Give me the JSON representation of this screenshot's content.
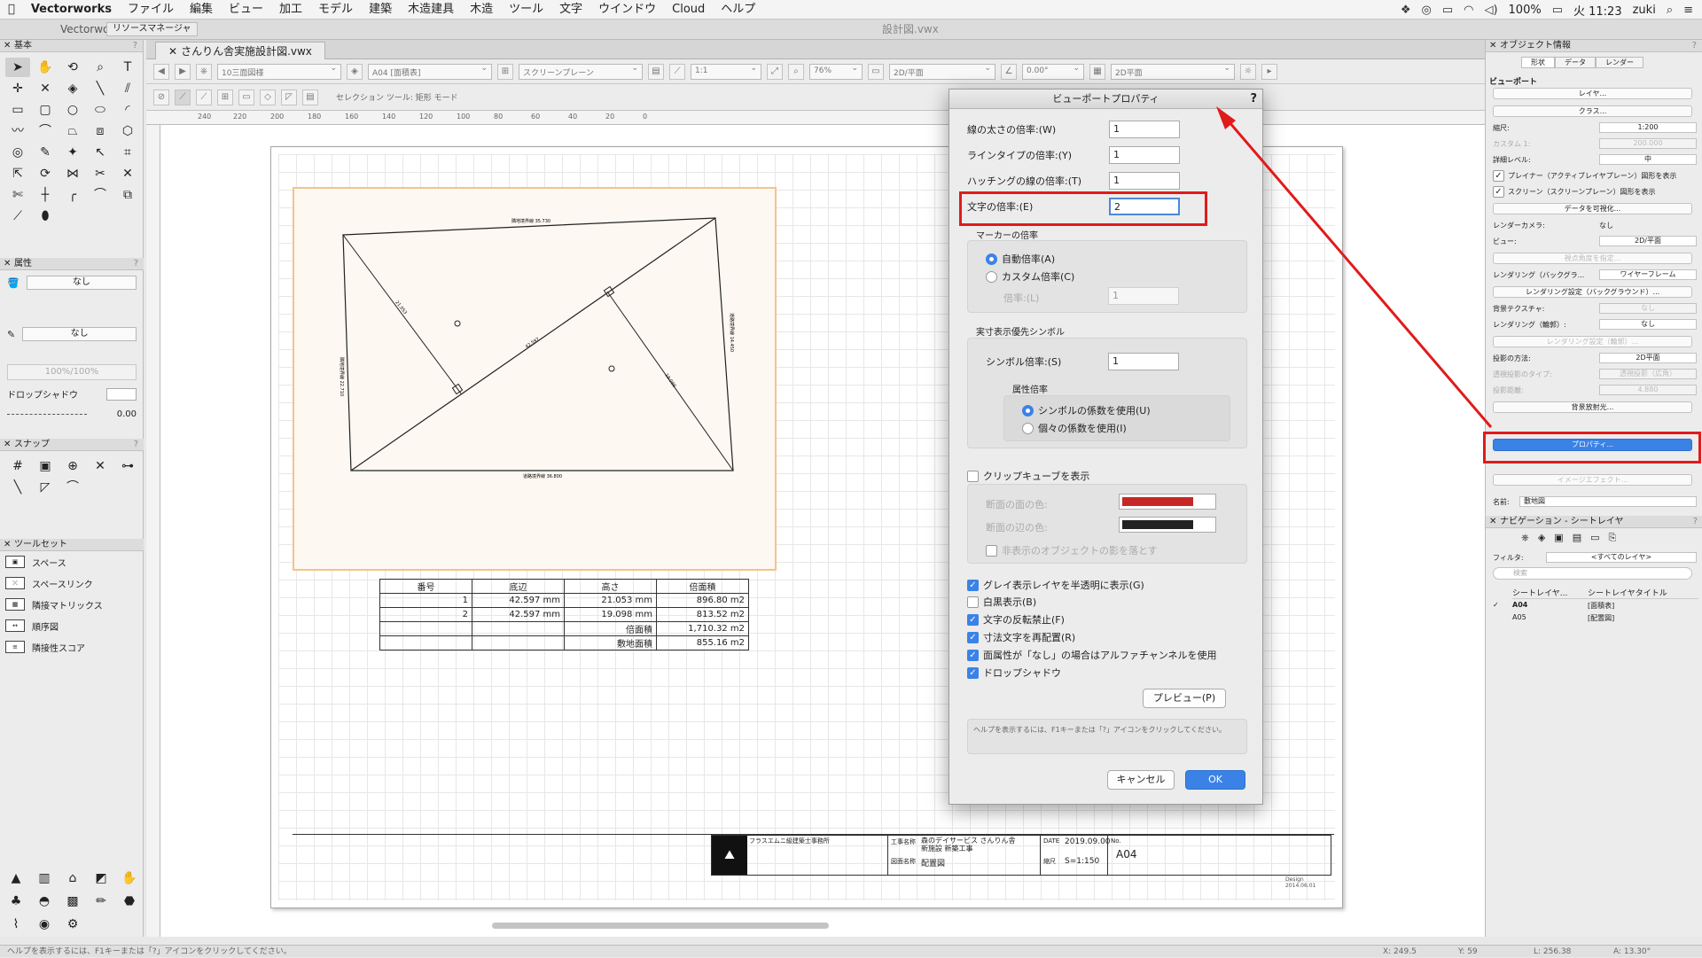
{
  "menubar": {
    "app": "Vectorworks",
    "items": [
      "ファイル",
      "編集",
      "ビュー",
      "加工",
      "モデル",
      "建築",
      "木造建具",
      "木造",
      "ツール",
      "文字",
      "ウインドウ",
      "Cloud",
      "ヘルプ"
    ],
    "battery": "100%",
    "date": "火 11:23",
    "user": "zuki"
  },
  "background_window_title": "Vectorworks",
  "background_doc_title": "設計図.vwx",
  "resource_manager": "リソースマネージャ",
  "doc_tab": "さんりん舎実施設計図.vwx",
  "toolbar": {
    "class": "10三面図様",
    "layer": "A04 [面積表]",
    "plane": "スクリーンプレーン",
    "scale": "1:1",
    "zoom": "76%",
    "view": "2D/平面",
    "angle": "0.00°",
    "render": "2D平面"
  },
  "mode_label": "セレクション ツール: 矩形 モード",
  "left": {
    "basic": "基本",
    "attributes": "属性",
    "fill": "なし",
    "pen": "なし",
    "opacity": "100%/100%",
    "dropshadow": "ドロップシャドウ",
    "lineweight": "0.00",
    "snap": "スナップ",
    "toolset": "ツールセット",
    "toolset_items": [
      "スペース",
      "スペースリンク",
      "隣接マトリックス",
      "順序図",
      "隣接性スコア"
    ]
  },
  "drawing": {
    "top_edge": "隣地境界線 35.730",
    "bottom_edge": "道路境界線 36.800",
    "left_edge": "隣地境界線 22.710",
    "right_edge": "道路境界線 14.450",
    "diag": "42.597",
    "h1": "21.053",
    "h2": "19.098"
  },
  "area_table": {
    "header": [
      "番号",
      "底辺",
      "高さ",
      "倍面積"
    ],
    "rows": [
      [
        "1",
        "42.597 mm",
        "21.053 mm",
        "896.80 m2"
      ],
      [
        "2",
        "42.597 mm",
        "19.098 mm",
        "813.52 m2"
      ],
      [
        "",
        "",
        "倍面積",
        "1,710.32 m2"
      ],
      [
        "",
        "",
        "敷地面積",
        "855.16 m2"
      ]
    ]
  },
  "titleblock": {
    "office": "フラスエムニ級建築士事務所",
    "project_label": "工事名称",
    "project": "森のデイサービス さんりん舎",
    "project2": "新施設 新築工事",
    "drawing_label": "図面名称",
    "drawing": "配置図",
    "date_label": "DATE",
    "date": "2019.09.00",
    "scale_label": "縮尺",
    "scale": "S=1:150",
    "no_label": "No.",
    "no": "A04",
    "design": "Design 2014.06.01"
  },
  "dialog": {
    "title": "ビューポートプロパティ",
    "help": "?",
    "line_weight_label": "線の太さの倍率:(W)",
    "line_weight": "1",
    "line_type_label": "ラインタイプの倍率:(Y)",
    "line_type": "1",
    "hatch_label": "ハッチングの線の倍率:(T)",
    "hatch": "1",
    "text_label": "文字の倍率:(E)",
    "text": "2",
    "marker_label": "マーカーの倍率",
    "marker_auto": "自動倍率(A)",
    "marker_custom": "カスタム倍率(C)",
    "marker_scale_label": "倍率:(L)",
    "marker_scale": "1",
    "symbol_section": "実寸表示優先シンボル",
    "symbol_label": "シンボル倍率:(S)",
    "symbol": "1",
    "attr_section": "属性倍率",
    "attr_symbol": "シンボルの係数を使用(U)",
    "attr_each": "個々の係数を使用(I)",
    "clipcube": "クリップキューブを表示",
    "section_fill": "断面の面の色:",
    "section_edge": "断面の辺の色:",
    "hidden_shadow": "非表示のオブジェクトの影を落とす",
    "gray_layers": "グレイ表示レイヤを半透明に表示(G)",
    "bw": "白黒表示(B)",
    "no_flip": "文字の反転禁止(F)",
    "dim_relocate": "寸法文字を再配置(R)",
    "alpha": "面属性が「なし」の場合はアルファチャンネルを使用",
    "shadow": "ドロップシャドウ",
    "preview": "プレビュー(P)",
    "help_text": "ヘルプを表示するには、F1キーまたは「?」アイコンをクリックしてください。",
    "cancel": "キャンセル",
    "ok": "OK",
    "fill_color": "#c62828",
    "edge_color": "#222222"
  },
  "obj_info": {
    "title": "オブジェクト情報",
    "tabs": [
      "形状",
      "データ",
      "レンダー"
    ],
    "section": "ビューポート",
    "layer_btn": "レイヤ...",
    "class_btn": "クラス...",
    "scale_label": "縮尺:",
    "scale": "1:200",
    "custom_label": "カスタム 1:",
    "custom": "200.000",
    "detail_label": "詳細レベル:",
    "detail": "中",
    "planar": "プレイナー（アクティブレイヤプレーン）図形を表示",
    "screen": "スクリーン（スクリーンプレーン）図形を表示",
    "visualize": "データを可視化...",
    "camera_label": "レンダーカメラ:",
    "camera": "なし",
    "view_label": "ビュー:",
    "view": "2D/平面",
    "align": "視点角度を指定...",
    "bg_render_label": "レンダリング（バックグラ...",
    "bg_render": "ワイヤーフレーム",
    "bg_settings": "レンダリング設定（バックグラウンド）...",
    "bg_tex_label": "背景テクスチャ:",
    "bg_tex": "なし",
    "line_render_label": "レンダリング（輪郭）:",
    "line_render": "なし",
    "line_settings": "レンダリング設定（輪郭）...",
    "proj_label": "投影の方法:",
    "proj": "2D平面",
    "persp_label": "透視投影のタイプ:",
    "persp": "透視投影（広角）",
    "dist_label": "投影距離:",
    "dist": "4.880",
    "bg_reflect": "背景放射光...",
    "properties": "プロパティ...",
    "image_effect": "イメージエフェクト...",
    "name_label": "名前:",
    "name": "敷地図"
  },
  "nav": {
    "title": "ナビゲーション - シートレイヤ",
    "filter_label": "フィルタ:",
    "filter": "<すべてのレイヤ>",
    "search": "検索",
    "col1": "シートレイヤ...",
    "col2": "シートレイヤタイトル",
    "rows": [
      {
        "id": "A04",
        "title": "[面積表]",
        "checked": "✓"
      },
      {
        "id": "A05",
        "title": "[配置図]",
        "checked": ""
      }
    ]
  },
  "status": {
    "help": "ヘルプを表示するには、F1キーまたは「?」アイコンをクリックしてください。",
    "x": "X: 249.5",
    "y": "Y: 59",
    "l": "L: 256.38",
    "a": "A: 13.30°"
  }
}
